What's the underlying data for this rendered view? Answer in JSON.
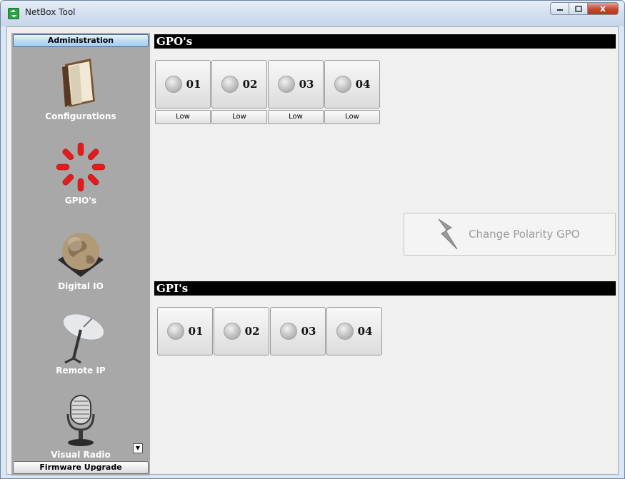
{
  "window": {
    "title": "NetBox Tool",
    "close_glyph": "x"
  },
  "sidebar": {
    "header": "Administration",
    "footer": "Firmware Upgrade",
    "items": [
      {
        "label": "Configurations",
        "icon": "book-icon"
      },
      {
        "label": "GPIO's",
        "icon": "spinner-icon"
      },
      {
        "label": "Digital IO",
        "icon": "globe-icon"
      },
      {
        "label": "Remote IP",
        "icon": "satellite-dish-icon"
      },
      {
        "label": "Visual Radio",
        "icon": "microphone-icon"
      }
    ]
  },
  "gpo": {
    "title": "GPO's",
    "items": [
      {
        "num": "01",
        "state": "Low"
      },
      {
        "num": "02",
        "state": "Low"
      },
      {
        "num": "03",
        "state": "Low"
      },
      {
        "num": "04",
        "state": "Low"
      }
    ],
    "polarity_label": "Change Polarity GPO"
  },
  "gpi": {
    "title": "GPI's",
    "items": [
      {
        "num": "01"
      },
      {
        "num": "02"
      },
      {
        "num": "03"
      },
      {
        "num": "04"
      }
    ]
  }
}
